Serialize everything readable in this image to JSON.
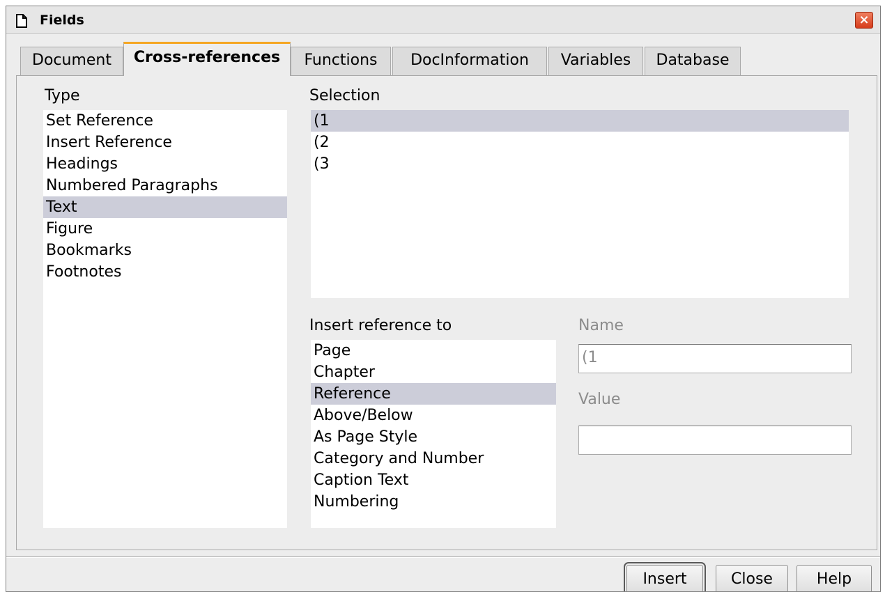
{
  "window": {
    "title": "Fields",
    "close_label": "×"
  },
  "tabs": [
    {
      "label": "Document"
    },
    {
      "label": "Cross-references"
    },
    {
      "label": "Functions"
    },
    {
      "label": "DocInformation"
    },
    {
      "label": "Variables"
    },
    {
      "label": "Database"
    }
  ],
  "type": {
    "label": "Type",
    "items": [
      "Set Reference",
      "Insert Reference",
      "Headings",
      "Numbered Paragraphs",
      "Text",
      "Figure",
      "Bookmarks",
      "Footnotes"
    ],
    "selected": "Text"
  },
  "selection": {
    "label": "Selection",
    "items": [
      "(1",
      "(2",
      "(3"
    ],
    "selected": "(1"
  },
  "insert_reference_to": {
    "label": "Insert reference to",
    "items": [
      "Page",
      "Chapter",
      "Reference",
      "Above/Below",
      "As Page Style",
      "Category and Number",
      "Caption Text",
      "Numbering"
    ],
    "selected": "Reference"
  },
  "name_field": {
    "label": "Name",
    "value": "(1"
  },
  "value_field": {
    "label": "Value",
    "value": ""
  },
  "buttons": {
    "insert": "Insert",
    "close": "Close",
    "help": "Help"
  }
}
